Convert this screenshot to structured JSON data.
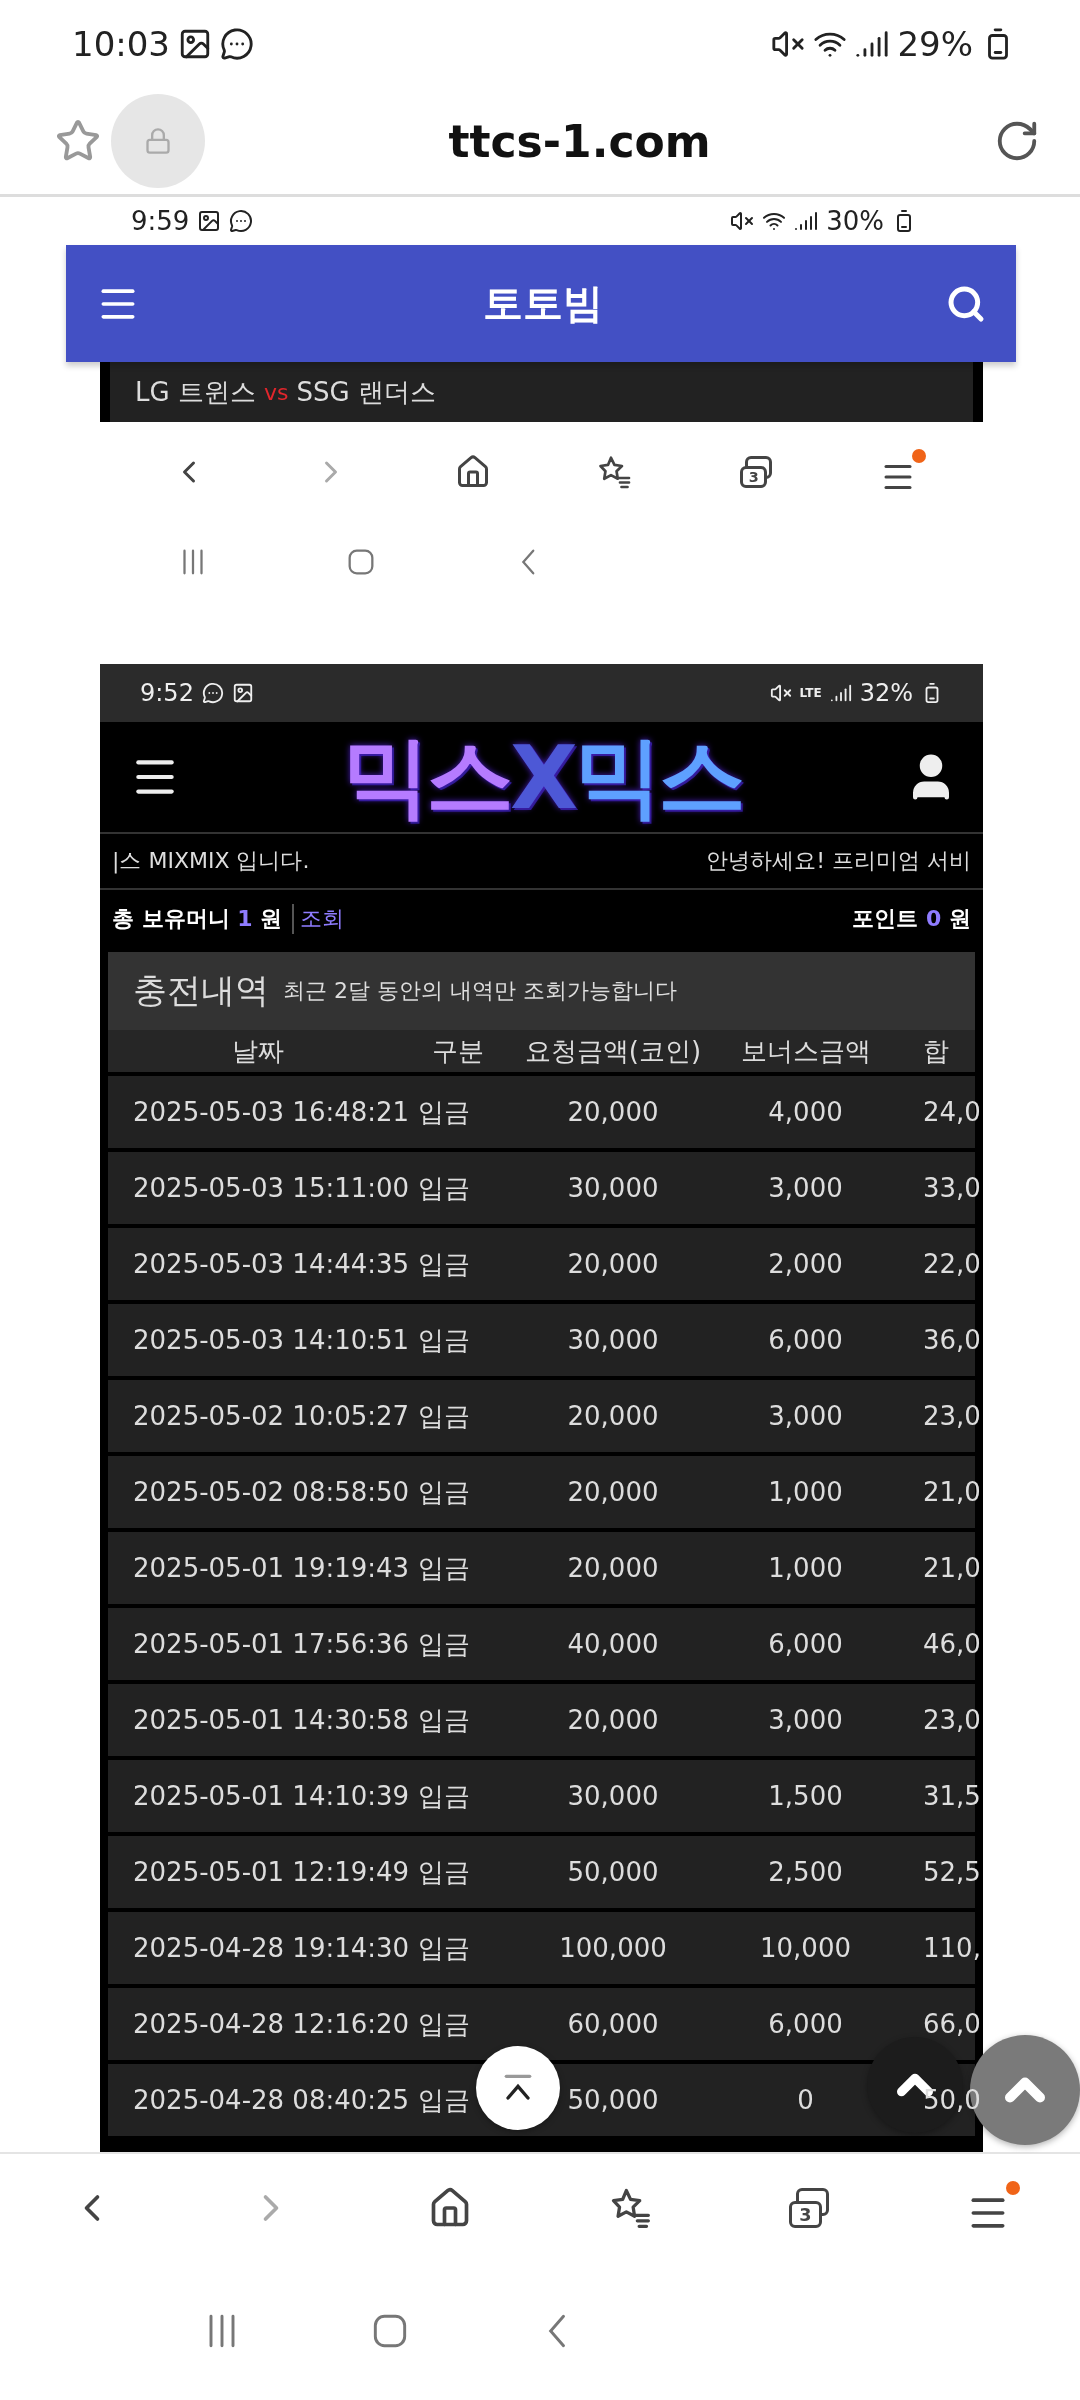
{
  "status_bar": {
    "time": "10:03",
    "battery": "29%"
  },
  "address_bar": {
    "url": "ttcs-1.com"
  },
  "screenshot_1": {
    "status_bar": {
      "time": "9:59",
      "battery": "30%"
    },
    "header": {
      "title": "토토빔"
    },
    "match": {
      "home": "LG 트윈스",
      "vs": "vs",
      "away": "SSG 랜더스"
    },
    "toolbar": {
      "tab_count": "3"
    }
  },
  "screenshot_2": {
    "status_bar": {
      "time": "9:52",
      "network": "LTE",
      "battery": "32%"
    },
    "logo": {
      "parts": [
        "믹스",
        "X",
        "믹스"
      ]
    },
    "marquee": [
      "|스 MIXMIX 입니다.",
      "안녕하세요! 프리미엄 서비"
    ],
    "balance": {
      "label": "총 보유머니",
      "amount": "1",
      "unit": "원",
      "link": "조회"
    },
    "points": {
      "label": "포인트",
      "amount": "0",
      "unit": "원"
    },
    "section": {
      "title": "충전내역",
      "note": "최근 2달 동안의 내역만 조회가능합니다"
    },
    "table": {
      "columns": [
        "날짜",
        "구분",
        "요청금액(코인)",
        "보너스금액",
        "합"
      ],
      "rows": [
        [
          "2025-05-03 16:48:21",
          "입금",
          "20,000",
          "4,000",
          "24,0"
        ],
        [
          "2025-05-03 15:11:00",
          "입금",
          "30,000",
          "3,000",
          "33,0"
        ],
        [
          "2025-05-03 14:44:35",
          "입금",
          "20,000",
          "2,000",
          "22,0"
        ],
        [
          "2025-05-03 14:10:51",
          "입금",
          "30,000",
          "6,000",
          "36,0"
        ],
        [
          "2025-05-02 10:05:27",
          "입금",
          "20,000",
          "3,000",
          "23,0"
        ],
        [
          "2025-05-02 08:58:50",
          "입금",
          "20,000",
          "1,000",
          "21,0"
        ],
        [
          "2025-05-01 19:19:43",
          "입금",
          "20,000",
          "1,000",
          "21,0"
        ],
        [
          "2025-05-01 17:56:36",
          "입금",
          "40,000",
          "6,000",
          "46,0"
        ],
        [
          "2025-05-01 14:30:58",
          "입금",
          "20,000",
          "3,000",
          "23,0"
        ],
        [
          "2025-05-01 14:10:39",
          "입금",
          "30,000",
          "1,500",
          "31,5"
        ],
        [
          "2025-05-01 12:19:49",
          "입금",
          "50,000",
          "2,500",
          "52,5"
        ],
        [
          "2025-04-28 19:14:30",
          "입금",
          "100,000",
          "10,000",
          "110,"
        ],
        [
          "2025-04-28 12:16:20",
          "입금",
          "60,000",
          "6,000",
          "66,0"
        ],
        [
          "2025-04-28 08:40:25",
          "입금",
          "50,000",
          "0",
          "50,0"
        ]
      ]
    }
  },
  "bottom_toolbar": {
    "tab_count": "3"
  }
}
